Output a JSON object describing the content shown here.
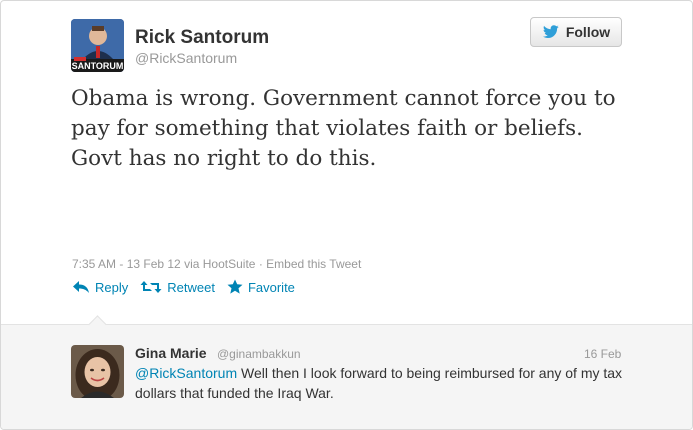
{
  "tweet": {
    "author": {
      "name": "Rick Santorum",
      "screen_name": "@RickSantorum",
      "avatar_text": "SANTORUM"
    },
    "follow_button": {
      "label": "Follow"
    },
    "text": "Obama is wrong. Government cannot force you to pay for something that violates faith or beliefs. Govt has no right to do this.",
    "meta": {
      "timestamp": "7:35 AM - 13 Feb 12",
      "via_prefix": "via",
      "source": "HootSuite",
      "separator": "·",
      "embed": "Embed this Tweet"
    },
    "actions": {
      "reply": "Reply",
      "retweet": "Retweet",
      "favorite": "Favorite"
    }
  },
  "reply": {
    "name": "Gina Marie",
    "screen_name": "@ginambakkun",
    "date": "16 Feb",
    "mention": "@RickSantorum",
    "text": " Well then I look forward to being reimbursed for any of my tax dollars that funded the Iraq War."
  },
  "colors": {
    "link": "#0084b4",
    "muted": "#999999",
    "text": "#333333",
    "reply_bg": "#f5f5f5"
  }
}
